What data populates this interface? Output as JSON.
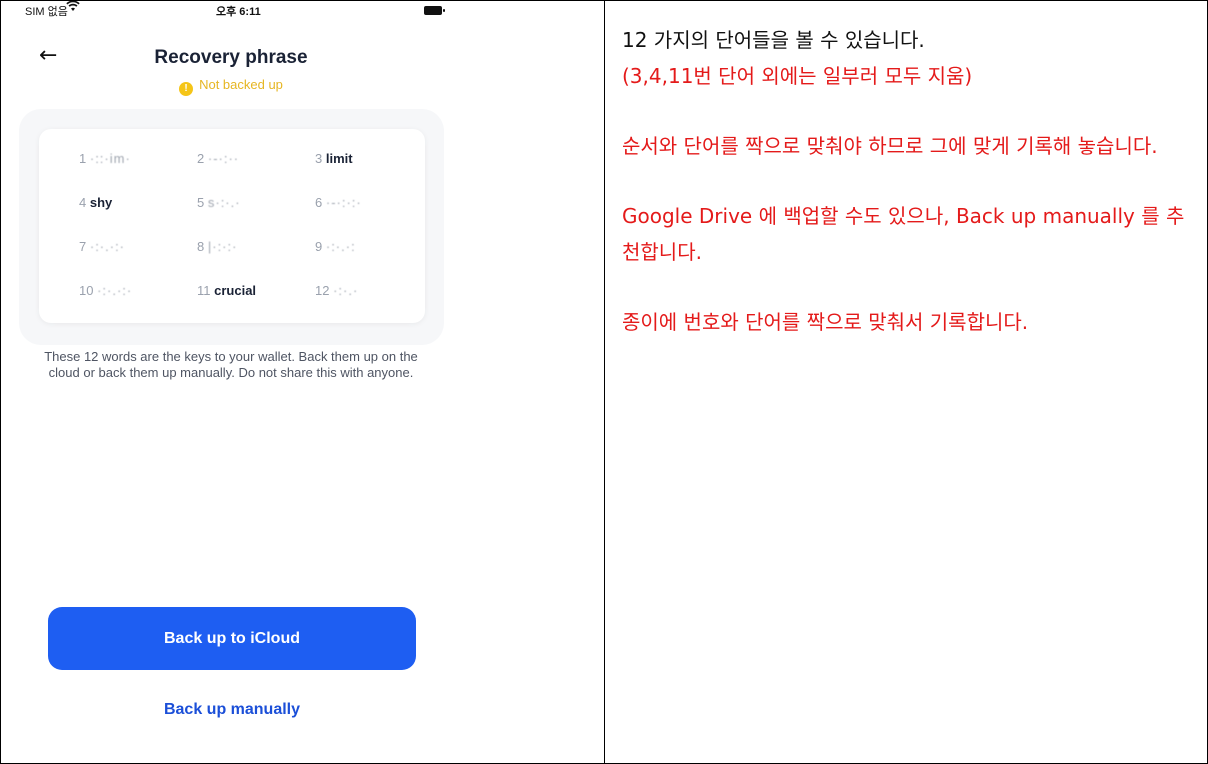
{
  "status_bar": {
    "carrier": "SIM 없음",
    "time": "오후 6:11",
    "wifi_icon": "wifi-icon",
    "battery_icon": "battery-icon"
  },
  "header": {
    "back_icon": "arrow-left-icon",
    "title": "Recovery phrase",
    "status": "Not backed up",
    "status_icon": "warning-icon",
    "status_color": "#e6b623"
  },
  "words": [
    {
      "num": "1",
      "word": "·::·im·",
      "hidden": true
    },
    {
      "num": "2",
      "word": "·-·:··",
      "hidden": true
    },
    {
      "num": "3",
      "word": "limit",
      "hidden": false
    },
    {
      "num": "4",
      "word": "shy",
      "hidden": false
    },
    {
      "num": "5",
      "word": "s·:·.·",
      "hidden": true
    },
    {
      "num": "6",
      "word": "·-·:·:·",
      "hidden": true
    },
    {
      "num": "7",
      "word": "·:·.·:·",
      "hidden": true
    },
    {
      "num": "8",
      "word": "|·:·:·",
      "hidden": true
    },
    {
      "num": "9",
      "word": "·:·.·:",
      "hidden": true
    },
    {
      "num": "10",
      "word": "·:·.·:·",
      "hidden": true
    },
    {
      "num": "11",
      "word": "crucial",
      "hidden": false
    },
    {
      "num": "12",
      "word": "·:·.·",
      "hidden": true
    }
  ],
  "description": "These 12 words are the keys to your wallet. Back them up on the cloud or back them up manually. Do not share this with anyone.",
  "buttons": {
    "primary": "Back up to iCloud",
    "secondary": "Back up manually"
  },
  "colors": {
    "primary": "#1e5ef2",
    "link": "#1b4fd8",
    "note_red": "#e41a1a"
  },
  "notes": {
    "line1": "12 가지의 단어들을 볼 수 있습니다.",
    "line2": "(3,4,11번 단어 외에는 일부러 모두 지움)",
    "para2": "순서와 단어를 짝으로 맞춰야 하므로 그에 맞게 기록해 놓습니다.",
    "para3": "Google Drive 에 백업할 수도 있으나, Back up manually 를 추천합니다.",
    "para4": "종이에 번호와 단어를 짝으로 맞춰서 기록합니다."
  }
}
